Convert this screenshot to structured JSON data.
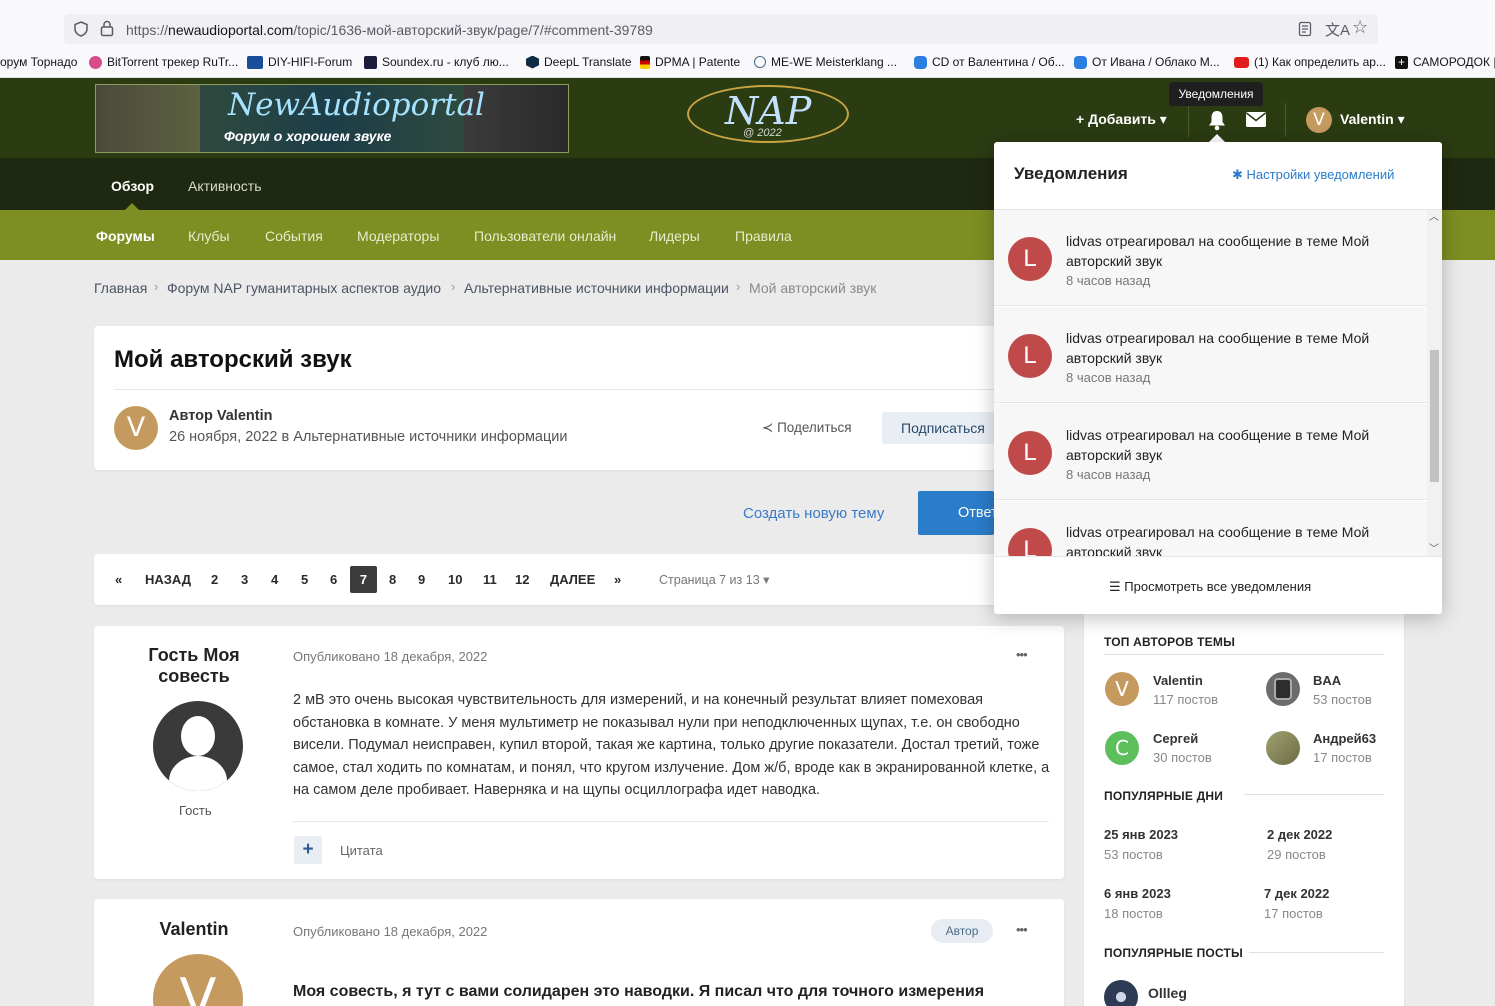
{
  "browser": {
    "url_prefix": "https://",
    "url_domain": "newaudioportal.com",
    "url_path": "/topic/1636-мой-авторский-звук/page/7/#comment-39789",
    "bookmarks": [
      "орум Торнадо",
      "BitTorrent трекер RuTr...",
      "DIY-HIFI-Forum",
      "Soundex.ru - клуб лю...",
      "DeepL Translate",
      "DPMA | Patente",
      "ME-WE Meisterklang ...",
      "CD от Валентина / Об...",
      "От Ивана / Облако М...",
      "(1) Как определить ар...",
      "САМОРОДОК |"
    ]
  },
  "header": {
    "logo_title": "NewAudioportal",
    "logo_subtitle": "Форум о хорошем звуке",
    "nap_logo": "NAP",
    "nap_year": "@ 2022",
    "add_label": "Добавить",
    "user_name": "Valentin",
    "user_initial": "V",
    "tooltip": "Уведомления"
  },
  "nav": {
    "primary": [
      "Обзор",
      "Активность"
    ],
    "secondary": [
      "Форумы",
      "Клубы",
      "События",
      "Модераторы",
      "Пользователи онлайн",
      "Лидеры",
      "Правила"
    ]
  },
  "breadcrumb": [
    "Главная",
    "Форум NAP гуманитарных аспектов аудио",
    "Альтернативные источники информации",
    "Мой авторский звук"
  ],
  "topic": {
    "title": "Мой авторский звук",
    "author_prefix": "Автор",
    "author": "Valentin",
    "author_initial": "V",
    "date_forum": "26 ноября, 2022 в Альтернативные источники информации",
    "share_label": "Поделиться",
    "follow_label": "Подписаться",
    "new_topic_label": "Создать новую тему",
    "reply_label": "Ответить"
  },
  "pagination": {
    "first": "«",
    "prev": "НАЗАД",
    "pages": [
      "2",
      "3",
      "4",
      "5",
      "6",
      "7",
      "8",
      "9",
      "10",
      "11",
      "12"
    ],
    "current": "7",
    "next": "ДАЛЕЕ",
    "last": "»",
    "page_of": "Страница 7 из 13"
  },
  "posts": [
    {
      "author": "Гость Моя совесть",
      "role": "Гость",
      "date": "Опубликовано 18 декабря, 2022",
      "text": "2 мВ это очень высокая чувствительность для измерений, и на конечный результат влияет помеховая обстановка в комнате. У меня мультиметр не показывал нули при неподключенных щупах, т.е. он свободно висели. Подумал неисправен, купил второй, такая же картина, только другие показатели. Достал третий, тоже самое, стал ходить по комнатам, и понял, что кругом излучение. Дом ж/б, вроде как в экранированной клетке, а на самом деле пробивает. Наверняка и на щупы осциллографа идет наводка.",
      "quote_label": "Цитата",
      "more": "•••"
    },
    {
      "author": "Valentin",
      "initial": "V",
      "date": "Опубликовано 18 декабря, 2022",
      "badge": "Автор",
      "text": "Моя совесть, я тут с вами солидарен это наводки. Я писал что для точного измерения",
      "more": "•••"
    }
  ],
  "notifications": {
    "title": "Уведомления",
    "settings_label": "Настройки уведомлений",
    "view_all_label": "Просмотреть все уведомления",
    "items": [
      {
        "initial": "L",
        "text": "lidvas отреагировал на сообщение в теме Мой авторский звук",
        "time": "8 часов назад"
      },
      {
        "initial": "L",
        "text": "lidvas отреагировал на сообщение в теме Мой авторский звук",
        "time": "8 часов назад"
      },
      {
        "initial": "L",
        "text": "lidvas отреагировал на сообщение в теме Мой авторский звук",
        "time": "8 часов назад"
      },
      {
        "initial": "L",
        "text": "lidvas отреагировал на сообщение в теме Мой авторский звук",
        "time": ""
      }
    ]
  },
  "sidebar": {
    "top_authors_title": "ТОП АВТОРОВ ТЕМЫ",
    "top_authors": [
      {
        "name": "Valentin",
        "posts": "117 постов",
        "initial": "V",
        "color": "#c59a5f"
      },
      {
        "name": "BAA",
        "posts": "53 постов",
        "initial": "",
        "color": "#6c6c6c"
      },
      {
        "name": "Сергей",
        "posts": "30 постов",
        "initial": "C",
        "color": "#5cbf5c"
      },
      {
        "name": "Андрей63",
        "posts": "17 постов",
        "initial": "",
        "color": "#8a8a5a"
      }
    ],
    "popular_days_title": "ПОПУЛЯРНЫЕ ДНИ",
    "popular_days": [
      {
        "date": "25 янв 2023",
        "posts": "53 постов"
      },
      {
        "date": "2 дек 2022",
        "posts": "29 постов"
      },
      {
        "date": "6 янв 2023",
        "posts": "18 постов"
      },
      {
        "date": "7 дек 2022",
        "posts": "17 постов"
      }
    ],
    "popular_posts_title": "ПОПУЛЯРНЫЕ ПОСТЫ",
    "popular_post_author": "Ollleg"
  }
}
